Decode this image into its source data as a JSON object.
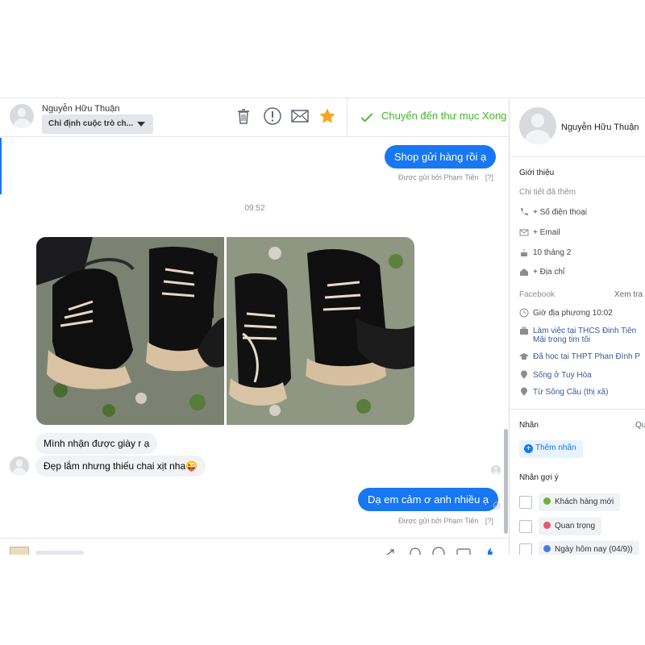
{
  "header": {
    "contact_name": "Nguyễn Hữu Thuận",
    "assign_label": "Chỉ định cuộc trò ch...",
    "done_label": "Chuyển đến thư mục Xong",
    "icons": [
      "trash-icon",
      "alert-icon",
      "mail-icon",
      "star-icon",
      "check-icon"
    ],
    "star_color": "#f5a623",
    "done_color": "#42b72a"
  },
  "messages": {
    "out1": "Shop gửi hàng rồi ạ",
    "sent_by1": "Được gửi bởi Phạm Tiến",
    "help1": "[?]",
    "time": "09:52",
    "in1": "Mình nhận được giày r ạ",
    "in2": "Đẹp lắm nhưng thiếu chai xịt nha😜",
    "out2": "Dạ em cảm ơ anh nhiều ạ",
    "sent_by2": "Được gửi bởi Phạm Tiến",
    "help2": "[?]"
  },
  "sidebar": {
    "name": "Nguyễn Hữu Thuận",
    "intro_title": "Giới thiệu",
    "details_added": "Chi tiết đã thêm",
    "phone": "+ Số điện thoại",
    "email": "+ Email",
    "birthday": "10 tháng 2",
    "address": "+ Địa chỉ",
    "facebook_title": "Facebook",
    "see_more": "Xem tra",
    "local_time": "Giờ địa phương 10:02",
    "work_line1": "Làm việc tại THCS Đinh Tiên",
    "work_line2": "Mãi trong tim tôi",
    "study": "Đã học tại THPT Phan Đình P",
    "lives": "Sống ở Tuy Hòa",
    "from": "Từ Sông Cầu (thị xã)",
    "labels_title": "Nhãn",
    "labels_manage": "Qu",
    "add_label": "Thêm nhãn",
    "suggested_title": "Nhãn gợi ý",
    "suggestions": [
      {
        "label": "Khách hàng mới",
        "color": "#6cb33e"
      },
      {
        "label": "Quan trọng",
        "color": "#e8566b"
      },
      {
        "label": "Ngày hôm nay (04/9))",
        "color": "#4a7be0"
      }
    ]
  },
  "colors": {
    "accent": "#1877f2"
  }
}
